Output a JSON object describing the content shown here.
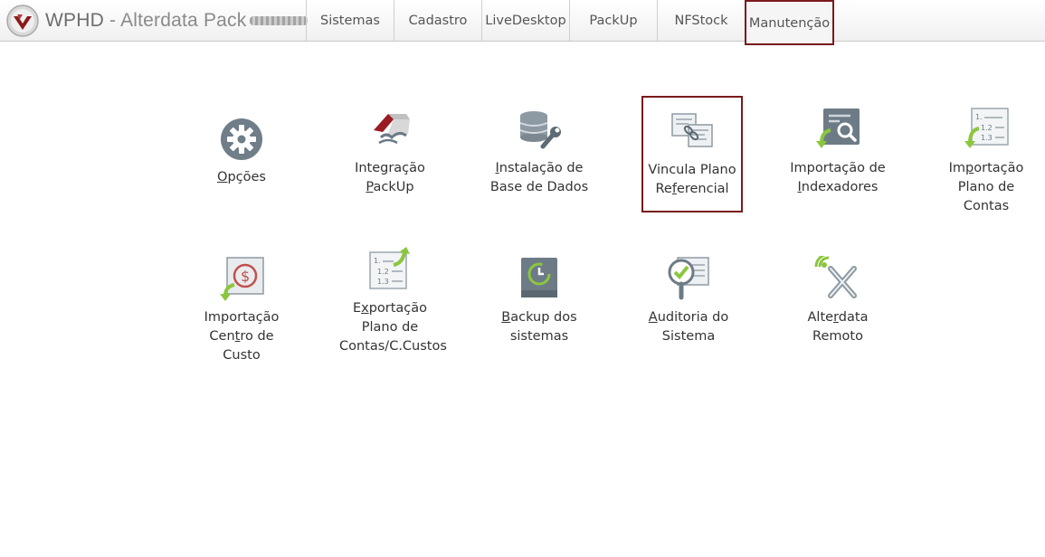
{
  "brand": {
    "name_strong": "WPHD",
    "name_rest": " - Alterdata Pack"
  },
  "menu": {
    "items": [
      "Sistemas",
      "Cadastro",
      "LiveDesktop",
      "PackUp",
      "NFStock",
      "Manutenção"
    ],
    "active": "Manutenção"
  },
  "tiles": {
    "opcoes": {
      "pre": "",
      "u": "O",
      "post": "pções"
    },
    "integracao": {
      "l1": "Integração",
      "l2pre": "",
      "l2u": "P",
      "l2post": "ackUp"
    },
    "instalacao": {
      "l1pre": "",
      "l1u": "I",
      "l1post": "nstalação de",
      "l2": "Base de Dados"
    },
    "vincula": {
      "l1": "Vincula Plano",
      "l2pre": "Re",
      "l2u": "f",
      "l2post": "erencial"
    },
    "indexadores": {
      "l1": "Importação de",
      "l2pre": "",
      "l2u": "I",
      "l2post": "ndexadores"
    },
    "plano_contas": {
      "l1pre": "Im",
      "l1u": "p",
      "l1post": "ortação",
      "l2": "Plano de Contas"
    },
    "centro_custo": {
      "l1": "Importação",
      "l2pre": "Cen",
      "l2u": "t",
      "l2post": "ro de Custo"
    },
    "exportacao": {
      "l1pre": "E",
      "l1u": "x",
      "l1post": "portação",
      "l2": "Plano de",
      "l3": "Contas/C.Custos"
    },
    "backup": {
      "l1pre": "",
      "l1u": "B",
      "l1post": "ackup dos",
      "l2": "sistemas"
    },
    "auditoria": {
      "l1pre": "",
      "l1u": "A",
      "l1post": "uditoria do",
      "l2": "Sistema"
    },
    "remoto": {
      "l1pre": "Alte",
      "l1u": "r",
      "l1post": "data",
      "l2": "Remoto"
    }
  },
  "colors": {
    "accent": "#7a1a1a",
    "green": "#8cc63f",
    "icon_gray": "#6d7b86"
  }
}
